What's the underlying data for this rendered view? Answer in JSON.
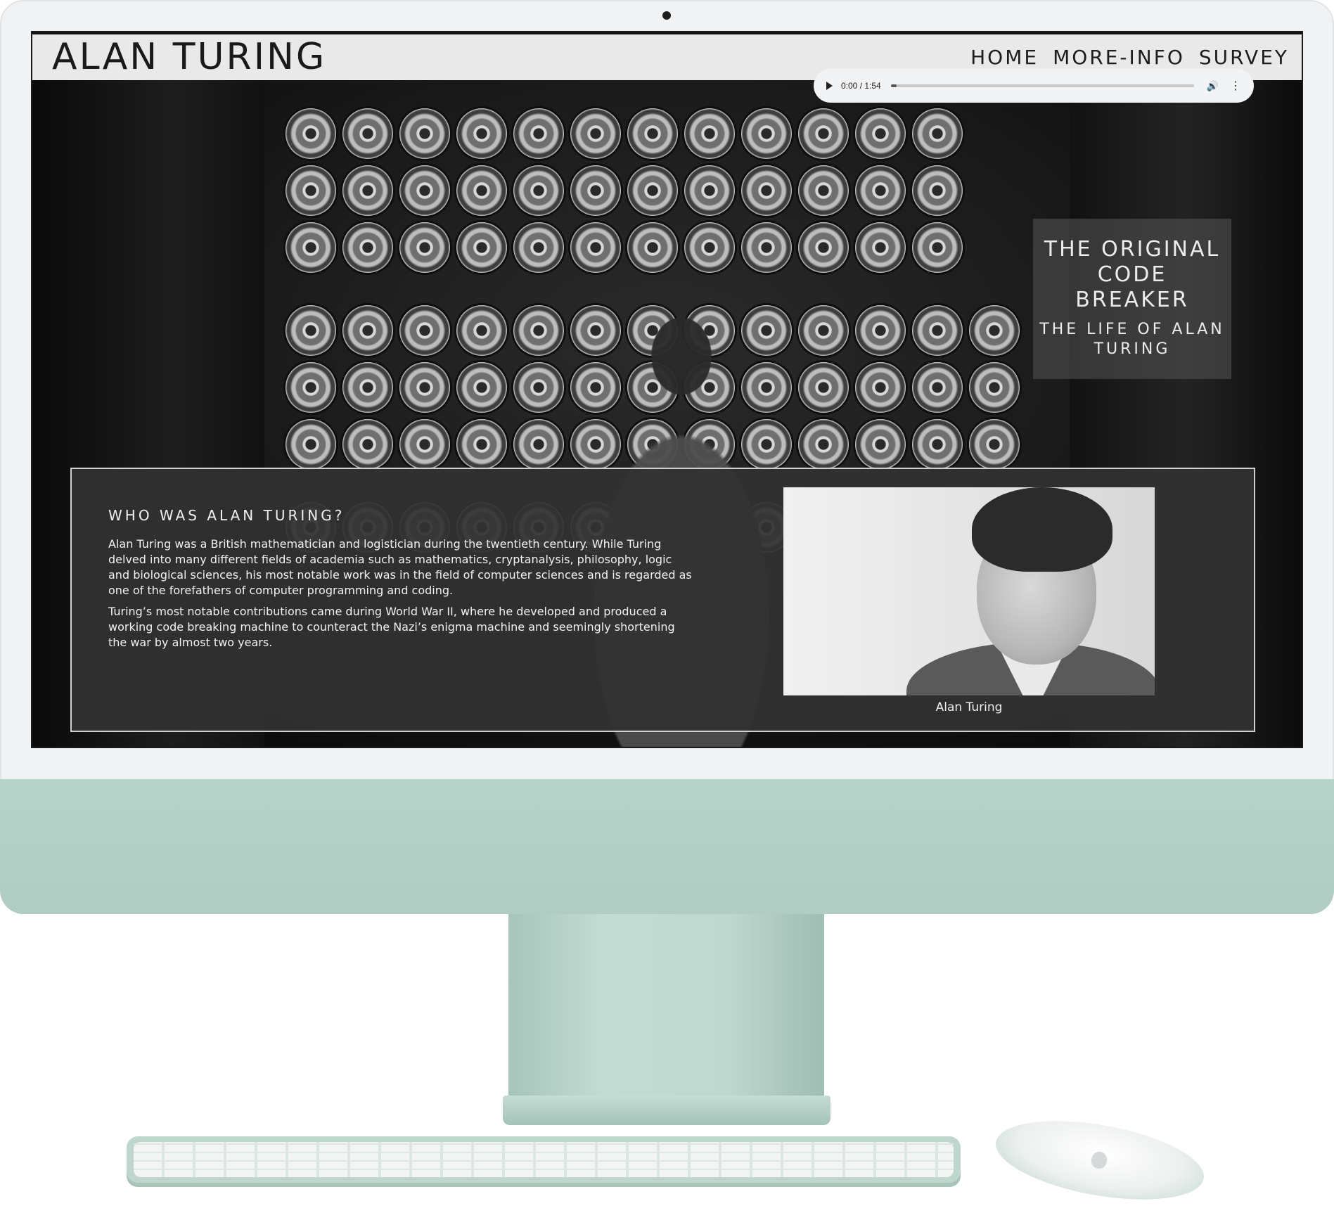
{
  "site": {
    "title": "ALAN TURING",
    "nav": [
      "HOME",
      "MORE-INFO",
      "SURVEY"
    ],
    "active_nav": "HOME"
  },
  "audio": {
    "time": "0:00 / 1:54",
    "progress": 0.0
  },
  "hero": {
    "headline": "THE ORIGINAL CODE BREAKER",
    "subheadline": "THE LIFE OF ALAN TURING"
  },
  "info": {
    "heading": "WHO WAS ALAN TURING?",
    "paragraphs": [
      "Alan Turing was a British mathematician and logistician during the twentieth century. While Turing delved into many different fields of academia such as mathematics, cryptanalysis, philosophy, logic and biological sciences, his most notable work was in the field of computer sciences and is regarded as one of the forefathers of computer programming and coding.",
      "Turing’s most notable contributions came during World War II, where he developed and produced a working code breaking machine to counteract the Nazi’s enigma machine and seemingly shortening the war by almost two years."
    ],
    "image_caption": "Alan Turing"
  },
  "icons": {
    "play": "play-icon",
    "volume": "volume-icon",
    "more": "more-vertical-icon",
    "camera": "camera-icon",
    "apple": "apple-logo-icon"
  },
  "colors": {
    "device_body": "#f1f2f3",
    "device_accent": "#b5d1c7",
    "header_bg": "#e9e9e9",
    "card_bg": "#323232"
  }
}
